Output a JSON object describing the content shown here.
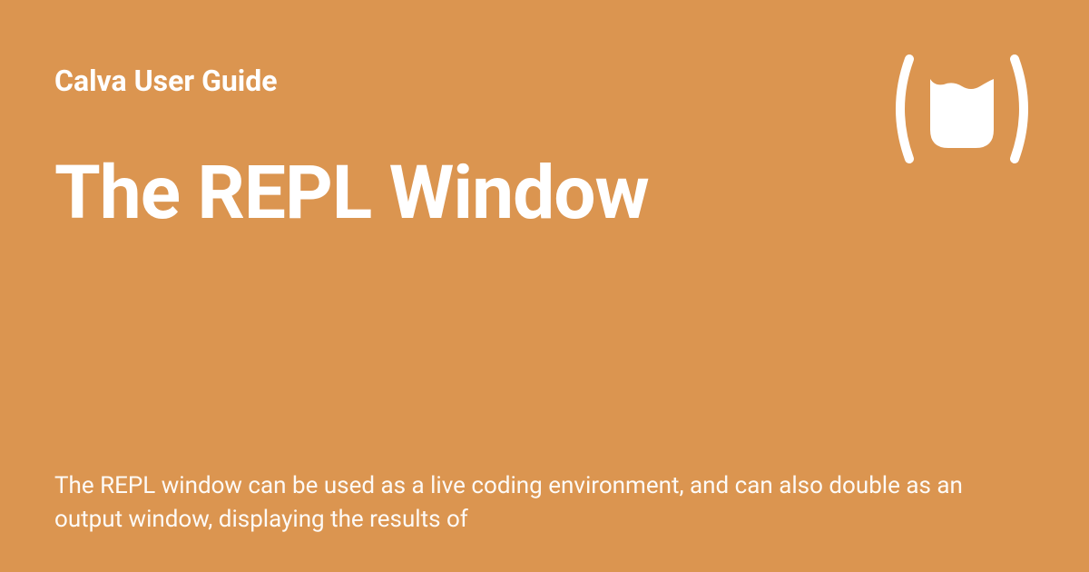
{
  "header": {
    "site_name": "Calva User Guide"
  },
  "main": {
    "title": "The REPL Window",
    "description": "The REPL window can be used as a live coding environment, and can also double as an output window, displaying the results of"
  },
  "colors": {
    "background": "#db9550",
    "text": "#ffffff"
  }
}
